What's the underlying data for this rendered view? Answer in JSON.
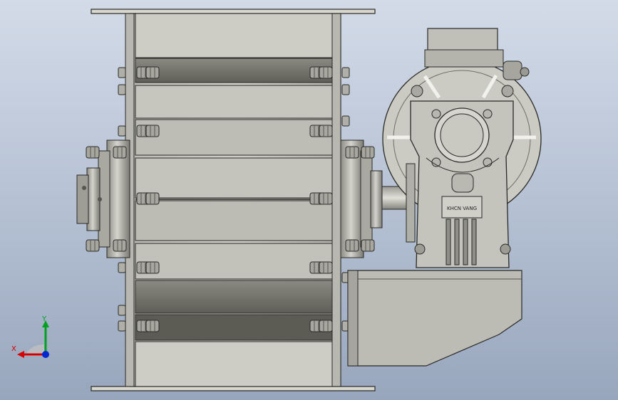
{
  "viewport": {
    "background_top": "#d3dbe8",
    "background_bottom": "#98a6bd"
  },
  "model": {
    "part_face_color": "#c8c8c0",
    "shadow_color": "#6e6e66",
    "outline_color": "#2a2a26",
    "gearbox_nameplate": "KHCN VANG"
  },
  "triad": {
    "x_label": "X",
    "y_label": "Y",
    "x_color": "#d40000",
    "y_color": "#00a020",
    "z_color": "#0028d0"
  }
}
